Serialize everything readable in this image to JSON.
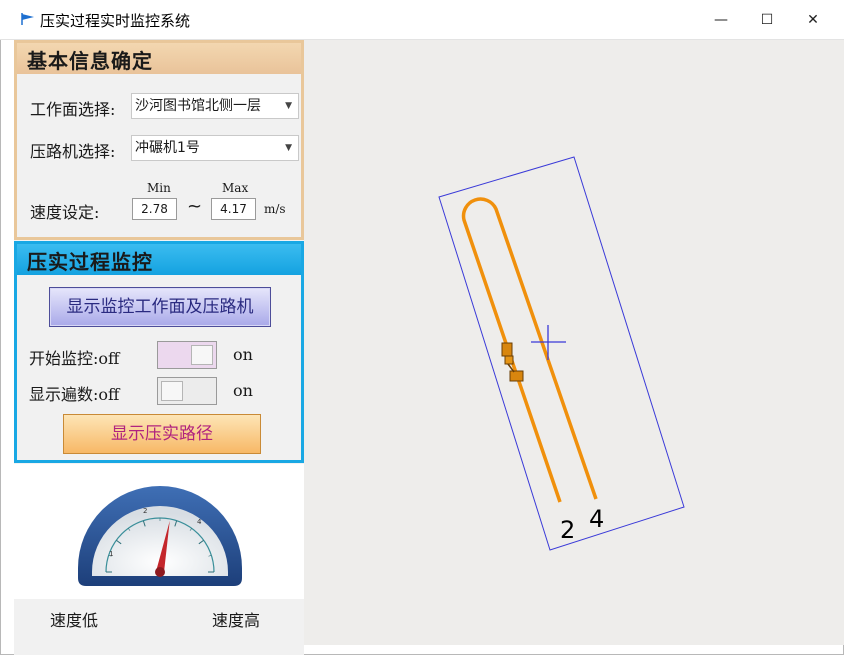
{
  "window": {
    "title": "压实过程实时监控系统",
    "minimize": "—",
    "maximize": "☐",
    "close": "✕"
  },
  "basic_info": {
    "title": "基本信息确定",
    "work_surface_label": "工作面选择:",
    "work_surface_value": "沙河图书馆北侧一层",
    "roller_label": "压路机选择:",
    "roller_value": "冲碾机1号",
    "speed_label": "速度设定:",
    "min_caption": "Min",
    "max_caption": "Max",
    "min_value": "2.78",
    "max_value": "4.17",
    "tilde": "~",
    "unit": "m/s"
  },
  "monitor": {
    "title": "压实过程监控",
    "show_button": "显示监控工作面及压路机",
    "start_monitor_label": "开始监控:",
    "show_passes_label": "显示遍数:",
    "off": "off",
    "on": "on",
    "show_path_button": "显示压实路径"
  },
  "gauge": {
    "min_label": "速度低",
    "max_label": "速度高",
    "tick_1": "1",
    "tick_2": "2",
    "tick_4": "4",
    "needle_value": 2.8,
    "scale_max": 5
  },
  "canvas": {
    "pass_label_a": "2",
    "pass_label_b": "4"
  },
  "colors": {
    "path": "#f0900c",
    "boundary": "#3a3ad8",
    "section1_border": "#e9c79a",
    "section2_border": "#19a8e4"
  },
  "icons": [
    "app-flag-icon",
    "dropdown-arrow-icon",
    "crosshair-icon",
    "roller-icon",
    "speed-gauge-icon"
  ]
}
